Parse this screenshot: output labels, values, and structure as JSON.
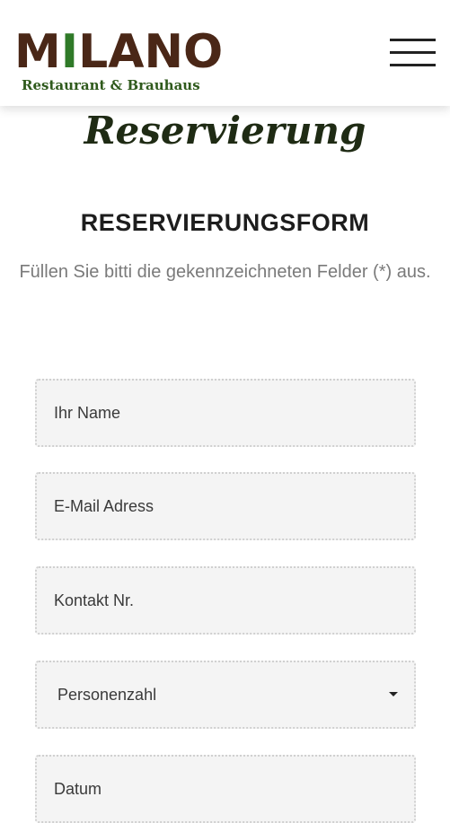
{
  "header": {
    "logo_name_prefix": "M",
    "logo_name_i": "I",
    "logo_name_suffix": "LANO",
    "logo_subtitle": "Restaurant & Brauhaus",
    "menu_icon": "hamburger-menu-icon"
  },
  "page": {
    "script_title": "Reservierung",
    "form_heading": "RESERVIERUNGSFORM",
    "intro": "Füllen Sie bitti die gekennzeichneten Felder (*) aus."
  },
  "form": {
    "name_placeholder": "Ihr Name",
    "email_placeholder": "E-Mail Adress",
    "phone_placeholder": "Kontakt Nr.",
    "persons_selected": "Personenzahl",
    "date_placeholder": "Datum"
  },
  "colors": {
    "logo_brown": "#4a2717",
    "logo_green": "#2f7a28",
    "field_background": "#f4f4f4",
    "intro_text": "#7a7a7a"
  }
}
